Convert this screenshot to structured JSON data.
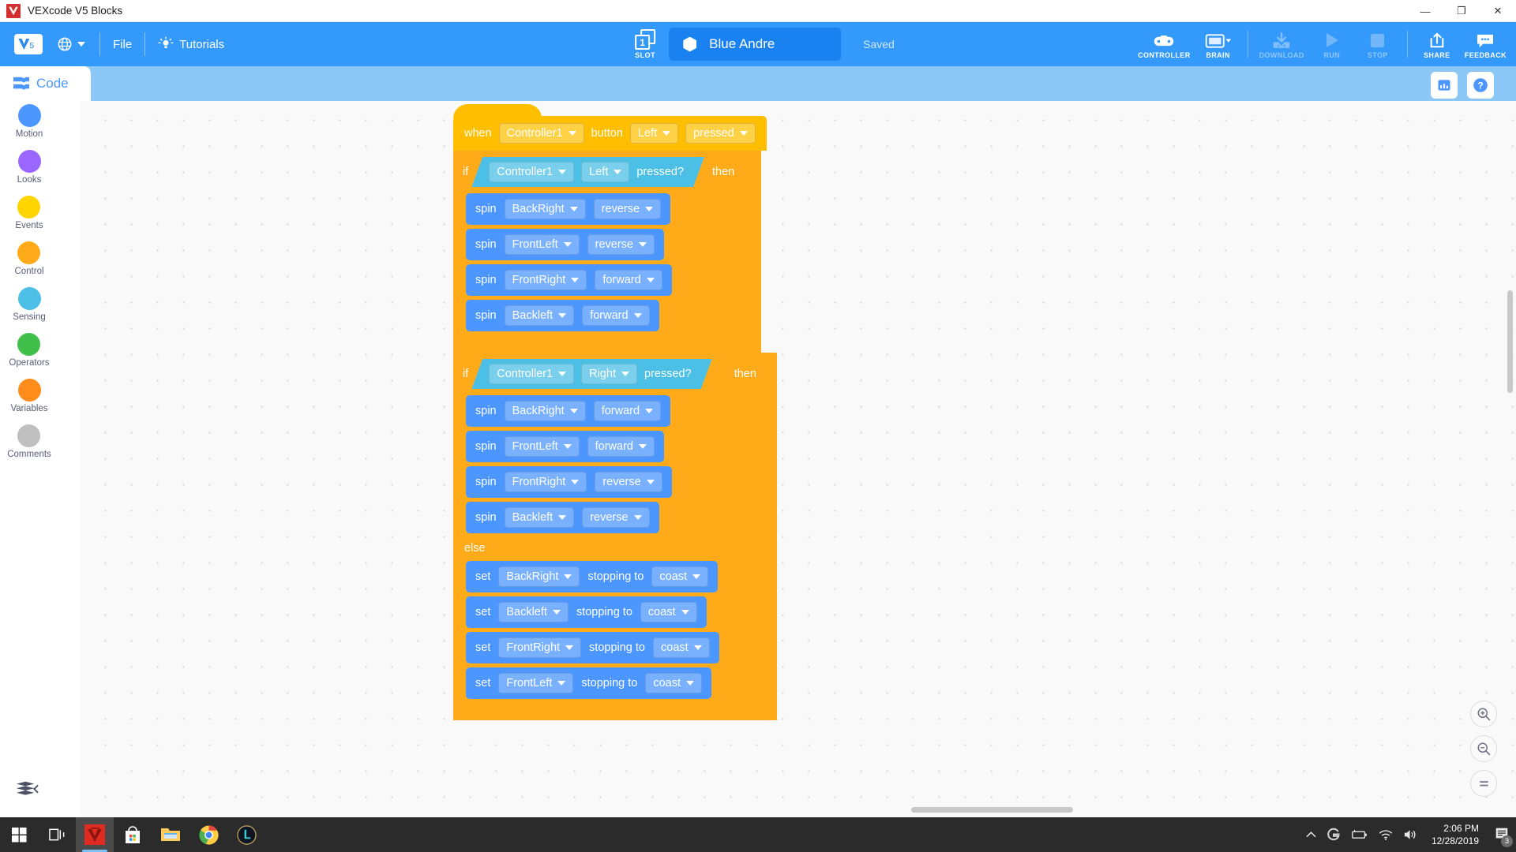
{
  "window": {
    "title": "VEXcode V5 Blocks",
    "minimize": "—",
    "maximize": "❐",
    "close": "✕"
  },
  "toolbar": {
    "logo_text": "V5",
    "file_label": "File",
    "tutorials_label": "Tutorials",
    "slot_number": "1",
    "slot_label": "SLOT",
    "project_name": "Blue Andre",
    "saved_label": "Saved",
    "buttons": [
      {
        "label": "CONTROLLER",
        "icon": "gamepad-icon",
        "disabled": false
      },
      {
        "label": "BRAIN",
        "icon": "brain-icon",
        "disabled": false
      },
      {
        "label": "DOWNLOAD",
        "icon": "download-icon",
        "disabled": true
      },
      {
        "label": "RUN",
        "icon": "play-icon",
        "disabled": true
      },
      {
        "label": "STOP",
        "icon": "stop-icon",
        "disabled": true
      },
      {
        "label": "SHARE",
        "icon": "share-icon",
        "disabled": false
      },
      {
        "label": "FEEDBACK",
        "icon": "feedback-icon",
        "disabled": false
      }
    ]
  },
  "sidebar": {
    "tab_label": "Code",
    "categories": [
      {
        "label": "Motion",
        "color": "#4c97ff"
      },
      {
        "label": "Looks",
        "color": "#9966ff"
      },
      {
        "label": "Events",
        "color": "#ffd500"
      },
      {
        "label": "Control",
        "color": "#ffab19"
      },
      {
        "label": "Sensing",
        "color": "#4cbfe6"
      },
      {
        "label": "Operators",
        "color": "#40bf4a"
      },
      {
        "label": "Variables",
        "color": "#ff8c1a"
      },
      {
        "label": "Comments",
        "color": "#bfbfbf"
      }
    ]
  },
  "workspace": {
    "dashboard_button": "dashboard-icon",
    "help_button": "help-icon",
    "zoom_in": "+",
    "zoom_out": "−",
    "zoom_reset": "="
  },
  "program": {
    "hat": {
      "when": "when",
      "device": "Controller1",
      "button_word": "button",
      "button": "Left",
      "action": "pressed"
    },
    "if_blocks": [
      {
        "if_label": "if",
        "then_label": "then",
        "condition": {
          "device": "Controller1",
          "button": "Left",
          "text": "pressed?"
        },
        "statements": [
          {
            "verb": "spin",
            "motor": "BackRight",
            "direction": "reverse"
          },
          {
            "verb": "spin",
            "motor": "FrontLeft",
            "direction": "reverse"
          },
          {
            "verb": "spin",
            "motor": "FrontRight",
            "direction": "forward"
          },
          {
            "verb": "spin",
            "motor": "Backleft",
            "direction": "forward"
          }
        ]
      },
      {
        "if_label": "if",
        "then_label": "then",
        "else_label": "else",
        "condition": {
          "device": "Controller1",
          "button": "Right",
          "text": "pressed?"
        },
        "statements": [
          {
            "verb": "spin",
            "motor": "BackRight",
            "direction": "forward"
          },
          {
            "verb": "spin",
            "motor": "FrontLeft",
            "direction": "forward"
          },
          {
            "verb": "spin",
            "motor": "FrontRight",
            "direction": "reverse"
          },
          {
            "verb": "spin",
            "motor": "Backleft",
            "direction": "reverse"
          }
        ],
        "else_statements": [
          {
            "verb": "set",
            "motor": "BackRight",
            "mid": "stopping to",
            "mode": "coast"
          },
          {
            "verb": "set",
            "motor": "Backleft",
            "mid": "stopping to",
            "mode": "coast"
          },
          {
            "verb": "set",
            "motor": "FrontRight",
            "mid": "stopping to",
            "mode": "coast"
          },
          {
            "verb": "set",
            "motor": "FrontLeft",
            "mid": "stopping to",
            "mode": "coast"
          }
        ]
      }
    ]
  },
  "taskbar": {
    "apps": [
      {
        "name": "start-button",
        "active": false
      },
      {
        "name": "task-view-button",
        "active": false
      },
      {
        "name": "vexcode-app",
        "active": true
      },
      {
        "name": "microsoft-store-app",
        "active": false
      },
      {
        "name": "file-explorer-app",
        "active": false
      },
      {
        "name": "chrome-app",
        "active": false
      },
      {
        "name": "league-of-legends-app",
        "active": false
      }
    ],
    "time": "2:06 PM",
    "date": "12/28/2019",
    "notification_count": "3"
  }
}
